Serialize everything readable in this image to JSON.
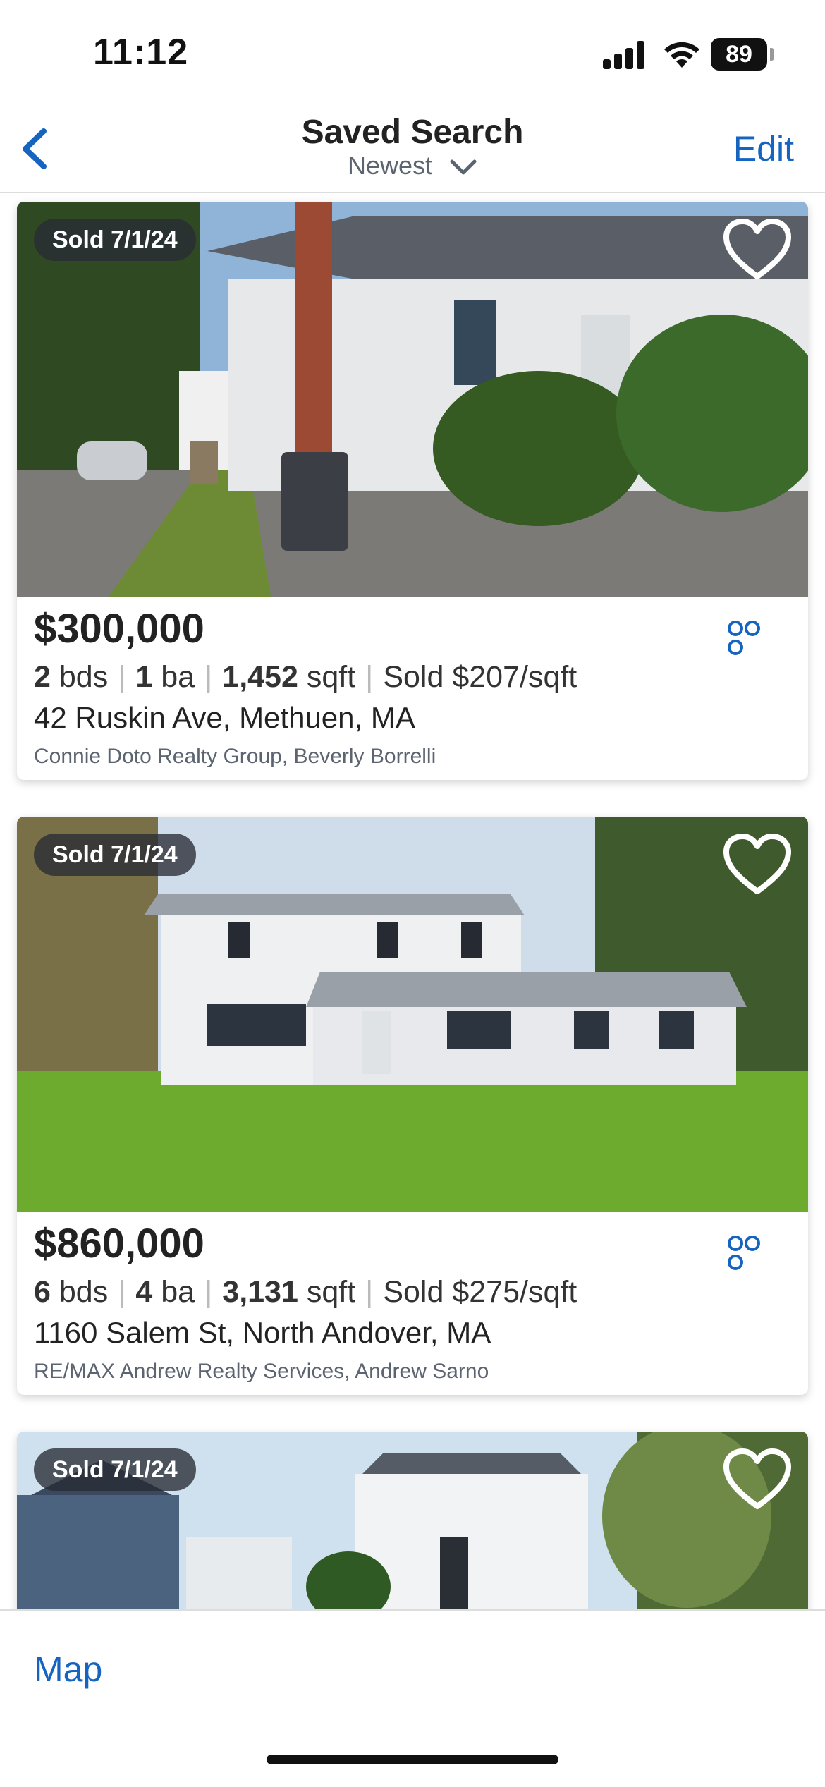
{
  "status": {
    "time": "11:12",
    "battery": "89"
  },
  "header": {
    "title": "Saved Search",
    "sort": "Newest",
    "edit_label": "Edit"
  },
  "listings": [
    {
      "badge": "Sold 7/1/24",
      "price": "$300,000",
      "beds": "2",
      "beds_unit": "bds",
      "baths": "1",
      "baths_unit": "ba",
      "sqft": "1,452",
      "sqft_unit": "sqft",
      "price_per_sqft": "Sold $207/sqft",
      "address": "42 Ruskin Ave, Methuen, MA",
      "agent": "Connie Doto Realty Group, Beverly Borrelli"
    },
    {
      "badge": "Sold 7/1/24",
      "price": "$860,000",
      "beds": "6",
      "beds_unit": "bds",
      "baths": "4",
      "baths_unit": "ba",
      "sqft": "3,131",
      "sqft_unit": "sqft",
      "price_per_sqft": "Sold $275/sqft",
      "address": "1160 Salem St, North Andover, MA",
      "agent": "RE/MAX Andrew Realty Services, Andrew Sarno"
    },
    {
      "badge": "Sold 7/1/24"
    }
  ],
  "bottom": {
    "map_label": "Map"
  },
  "colors": {
    "accent": "#1565c0",
    "badge_bg": "#2c3038"
  }
}
